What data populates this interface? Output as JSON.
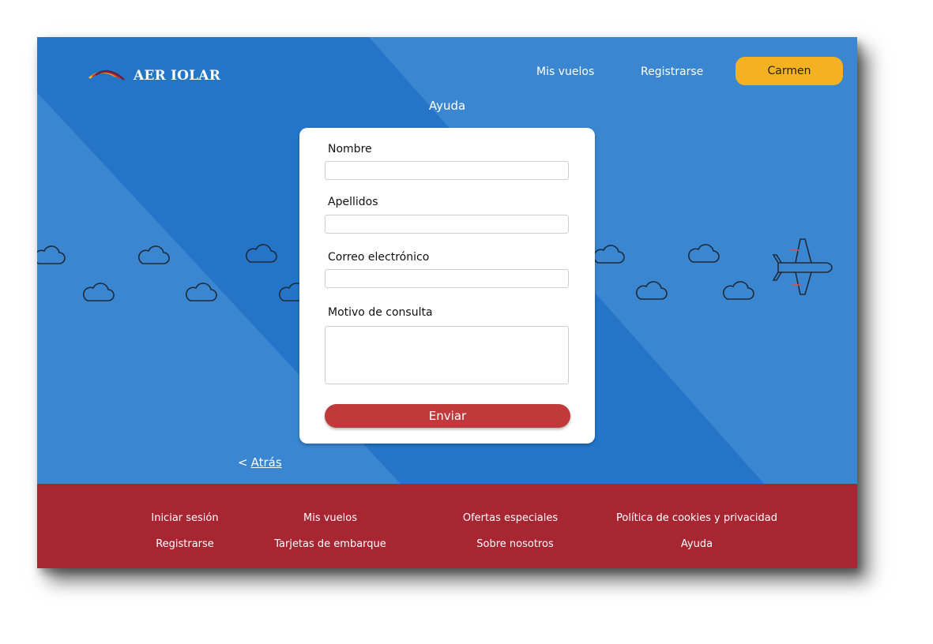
{
  "brand": {
    "name": "AER IOLAR"
  },
  "header": {
    "nav": [
      "Mis vuelos",
      "Registrarse"
    ],
    "user_button": "Carmen"
  },
  "page": {
    "title": "Ayuda"
  },
  "form": {
    "fields": [
      {
        "label": "Nombre",
        "value": ""
      },
      {
        "label": "Apellidos",
        "value": ""
      },
      {
        "label": "Correo electrónico",
        "value": ""
      },
      {
        "label": "Motivo de consulta",
        "value": ""
      }
    ],
    "submit": "Enviar"
  },
  "back": {
    "arrow": "<",
    "label": "Atrás"
  },
  "footer": {
    "links": [
      [
        "Iniciar sesión",
        "Registrarse"
      ],
      [
        "Mis vuelos",
        "Tarjetas de embarque"
      ],
      [
        "Ofertas especiales",
        "Sobre nosotros"
      ],
      [
        "Política de cookies y privacidad",
        "Ayuda"
      ]
    ]
  },
  "colors": {
    "sky": "#3a86d0",
    "accent": "#f4b222",
    "footer": "#a82532",
    "submit": "#c0393b"
  },
  "icons": [
    "logo-swoosh-icon",
    "cloud-icon",
    "airplane-icon"
  ]
}
